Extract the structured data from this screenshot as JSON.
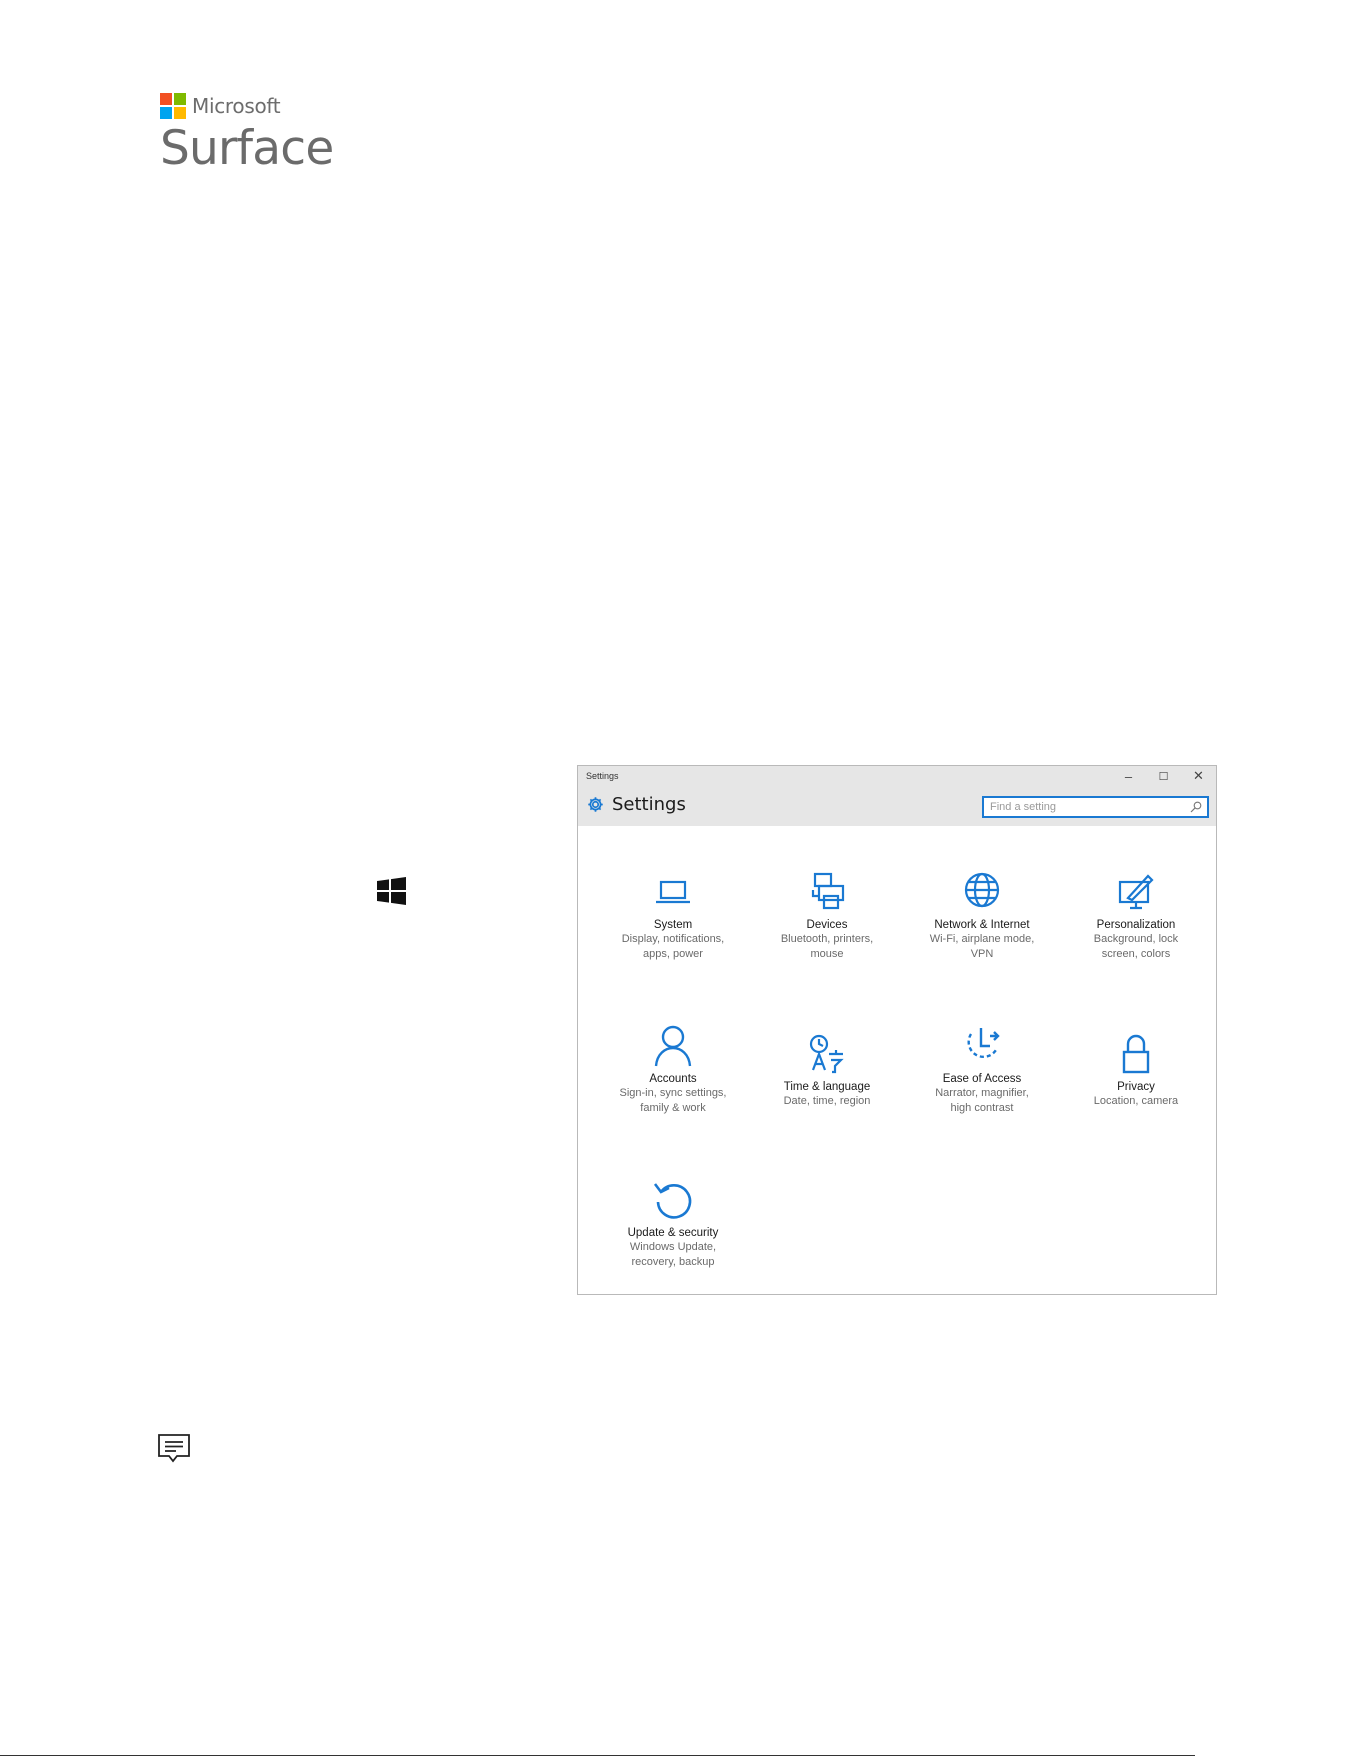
{
  "brand": {
    "microsoft": "Microsoft",
    "product": "Surface",
    "logo_colors": [
      "#f25022",
      "#7fba00",
      "#00a4ef",
      "#ffb900"
    ]
  },
  "document_icons": {
    "windows": "windows-logo-icon",
    "note": "note-icon"
  },
  "settings_window": {
    "caption": "Settings",
    "title": "Settings",
    "search_placeholder": "Find a setting",
    "controls": {
      "minimize": "–",
      "maximize": "☐",
      "close": "✕"
    },
    "accent_color": "#1a79d2",
    "tiles": [
      {
        "icon": "laptop-icon",
        "label": "System",
        "desc": "Display, notifications, apps, power"
      },
      {
        "icon": "printer-icon",
        "label": "Devices",
        "desc": "Bluetooth, printers, mouse"
      },
      {
        "icon": "globe-icon",
        "label": "Network & Internet",
        "desc": "Wi-Fi, airplane mode, VPN"
      },
      {
        "icon": "paintbrush-icon",
        "label": "Personalization",
        "desc": "Background, lock screen, colors"
      },
      {
        "icon": "person-icon",
        "label": "Accounts",
        "desc": "Sign-in, sync settings, family & work"
      },
      {
        "icon": "language-icon",
        "label": "Time & language",
        "desc": "Date, time, region"
      },
      {
        "icon": "ease-of-access-icon",
        "label": "Ease of Access",
        "desc": "Narrator, magnifier, high contrast"
      },
      {
        "icon": "lock-icon",
        "label": "Privacy",
        "desc": "Location, camera"
      },
      {
        "icon": "update-icon",
        "label": "Update & security",
        "desc": "Windows Update, recovery, backup"
      }
    ]
  }
}
